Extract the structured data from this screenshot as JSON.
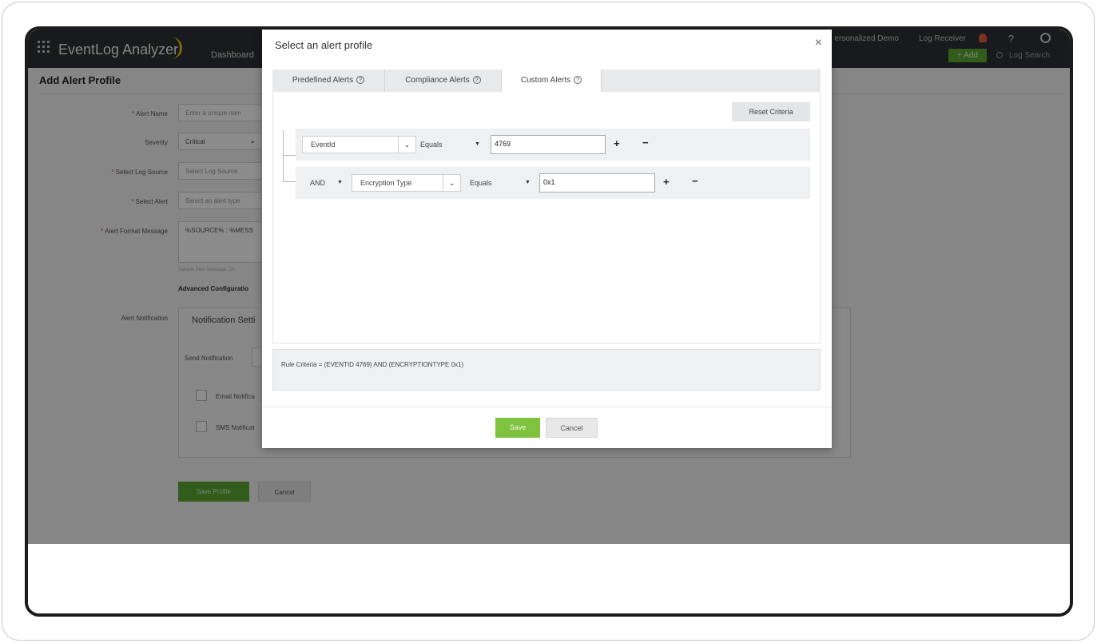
{
  "app": {
    "brand": "EventLog Analyzer",
    "nav_dashboard": "Dashboard",
    "top_personalized": "ersonalized Demo",
    "top_log_receiver": "Log Receiver",
    "top_help": "?",
    "add_label": "+ Add",
    "log_search": "Log Search"
  },
  "page": {
    "title": "Add Alert Profile",
    "fields": [
      {
        "label": "Alert Name",
        "required": true,
        "value": "Enter a unique nam"
      },
      {
        "label": "Severity",
        "required": false,
        "value": "Critical"
      },
      {
        "label": "Select Log Source",
        "required": true,
        "value": "Select Log Source"
      },
      {
        "label": "Select Alert",
        "required": true,
        "value": "Select an alert type"
      },
      {
        "label": "Alert Format Message",
        "required": true,
        "value": "%SOURCE% : %MESS"
      }
    ],
    "sample_message": "Sample Alert message: Us",
    "advanced_config": "Advanced Configuratio",
    "alert_notification_label": "Alert Notification",
    "notification_settings": "Notification Setti",
    "send_notification_label": "Send Notification",
    "email_notification": "Email Notifica",
    "sms_notification": "SMS Notificat",
    "save_profile": "Save Profile",
    "cancel": "Cancel"
  },
  "modal": {
    "title": "Select an alert profile",
    "close": "×",
    "tabs": [
      {
        "label": "Predefined Alerts",
        "active": false
      },
      {
        "label": "Compliance Alerts",
        "active": false
      },
      {
        "label": "Custom Alerts",
        "active": true
      }
    ],
    "help_glyph": "?",
    "reset_criteria": "Reset Criteria",
    "rows": [
      {
        "logic": "",
        "field": "EventId",
        "operator": "Equals",
        "value": "4769"
      },
      {
        "logic": "AND",
        "field": "Encryption Type",
        "operator": "Equals",
        "value": "0x1"
      }
    ],
    "plus": "+",
    "minus": "−",
    "chevron": "⌄",
    "caret": "▼",
    "rule_criteria": "Rule Criteria = (EVENTID 4769) AND (ENCRYPTIONTYPE 0x1)",
    "save": "Save",
    "cancel": "Cancel"
  },
  "colors": {
    "header_bg": "#2e3135",
    "accent_green": "#7fc23f",
    "required_red": "#e24a3b"
  }
}
